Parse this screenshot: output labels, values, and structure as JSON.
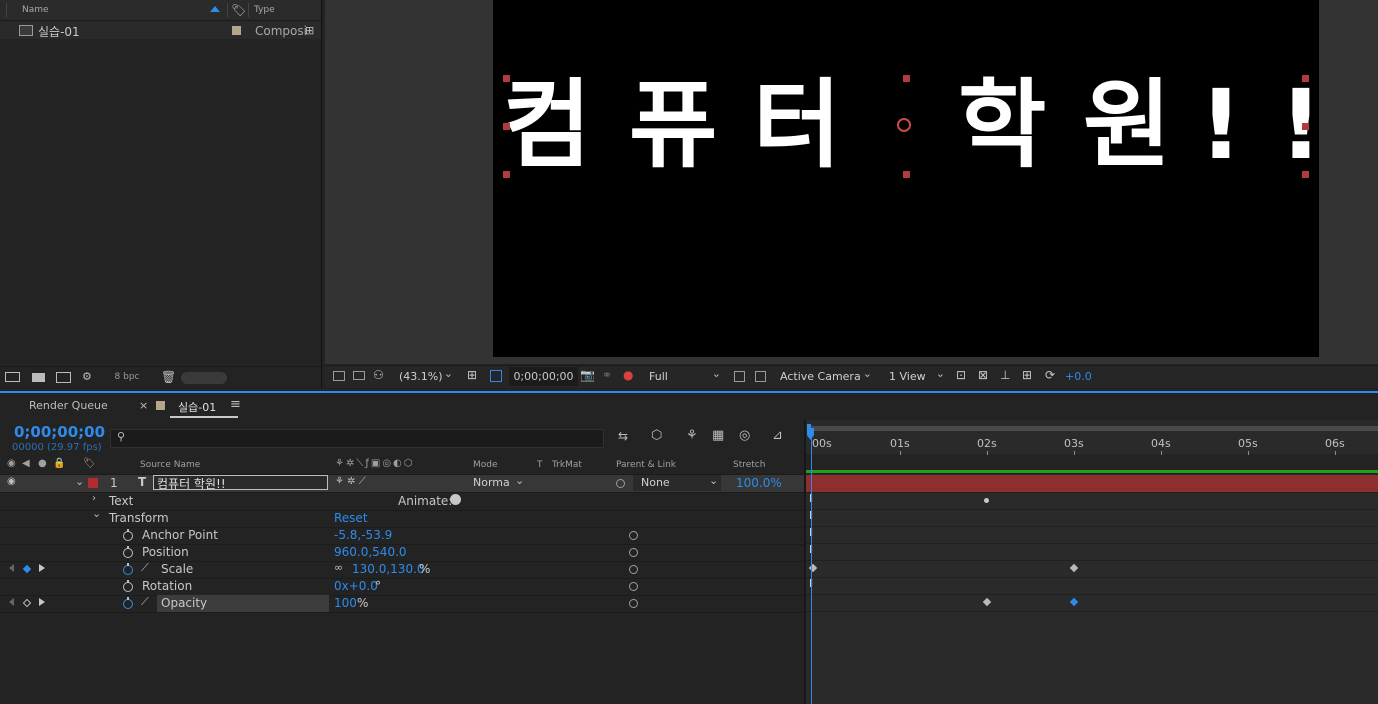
{
  "colors": {
    "accent": "#2d8ceb",
    "label_red": "#b52b2b",
    "comp_swatch": "#b6a689",
    "layer_bar": "#8f2e2e",
    "work_area": "#1fa11f"
  },
  "project": {
    "columns": {
      "name": "Name",
      "type": "Type"
    },
    "items": [
      {
        "icon": "composition-icon",
        "name": "실습-01",
        "type": "Composi"
      }
    ],
    "footer": {
      "bpc": "8 bpc"
    }
  },
  "viewer": {
    "composition_text": [
      "컴",
      "퓨",
      "터",
      "학",
      "원",
      "!",
      "!"
    ],
    "zoom": "(43.1%)",
    "timecode": "0;00;00;00",
    "resolution": "Full",
    "camera": "Active Camera",
    "views": "1 View",
    "exposure": "+0.0"
  },
  "timeline": {
    "tabs": {
      "render_queue": "Render Queue",
      "comp": "실습-01"
    },
    "timecode": "0;00;00;00",
    "frames": "00000 (29.97 fps)",
    "columns": {
      "source_name": "Source Name",
      "mode": "Mode",
      "t": "T",
      "trkmat": "TrkMat",
      "parent": "Parent & Link",
      "stretch": "Stretch"
    },
    "layer": {
      "index": "1",
      "type_icon": "T",
      "name": "컴퓨터 학원!!",
      "mode": "Norma",
      "parent": "None",
      "stretch": "100.0%"
    },
    "text_group": "Text",
    "animate": "Animate:",
    "transform": {
      "label": "Transform",
      "reset": "Reset"
    },
    "properties": [
      {
        "name": "Anchor Point",
        "value": "-5.8,-53.9",
        "unit": ""
      },
      {
        "name": "Position",
        "value": "960.0,540.0",
        "unit": ""
      },
      {
        "name": "Scale",
        "value": "130.0,130.0",
        "unit": "%"
      },
      {
        "name": "Rotation",
        "value": "0x+0.0",
        "unit": "°"
      },
      {
        "name": "Opacity",
        "value": "100",
        "unit": "%"
      }
    ],
    "ruler": [
      "00s",
      "01s",
      "02s",
      "03s",
      "04s",
      "05s",
      "06s"
    ]
  }
}
